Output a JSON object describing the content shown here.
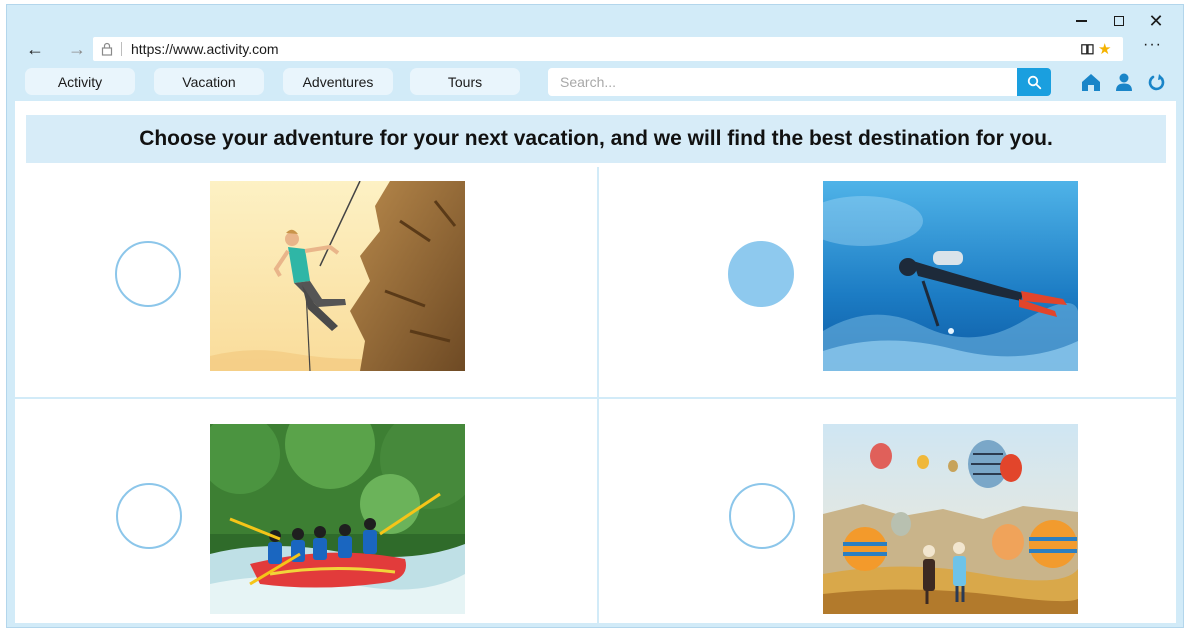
{
  "window": {
    "controls": [
      "minimize",
      "maximize",
      "close"
    ]
  },
  "browser": {
    "url": "https://www.activity.com",
    "icons": [
      "back-arrow-icon",
      "forward-arrow-icon",
      "lock-icon",
      "reader-view-icon",
      "favorite-star-icon",
      "more-options-icon"
    ]
  },
  "nav": {
    "tabs": [
      "Activity",
      "Vacation",
      "Adventures",
      "Tours"
    ],
    "search_placeholder": "Search...",
    "tool_icons": [
      "home-icon",
      "user-icon",
      "refresh-icon"
    ]
  },
  "main": {
    "heading": "Choose your adventure for your next vacation, and we will find the best destination for you.",
    "options": [
      {
        "image": "rock-climbing-photo",
        "selected": false
      },
      {
        "image": "scuba-diving-photo",
        "selected": true
      },
      {
        "image": "river-rafting-photo",
        "selected": false
      },
      {
        "image": "hot-air-balloons-photo",
        "selected": false
      }
    ]
  },
  "colors": {
    "window_bg": "#d2ebf8",
    "accent": "#1a9fdf",
    "radio_border": "#8cc6ea",
    "radio_selected": "#8ec9ee"
  }
}
